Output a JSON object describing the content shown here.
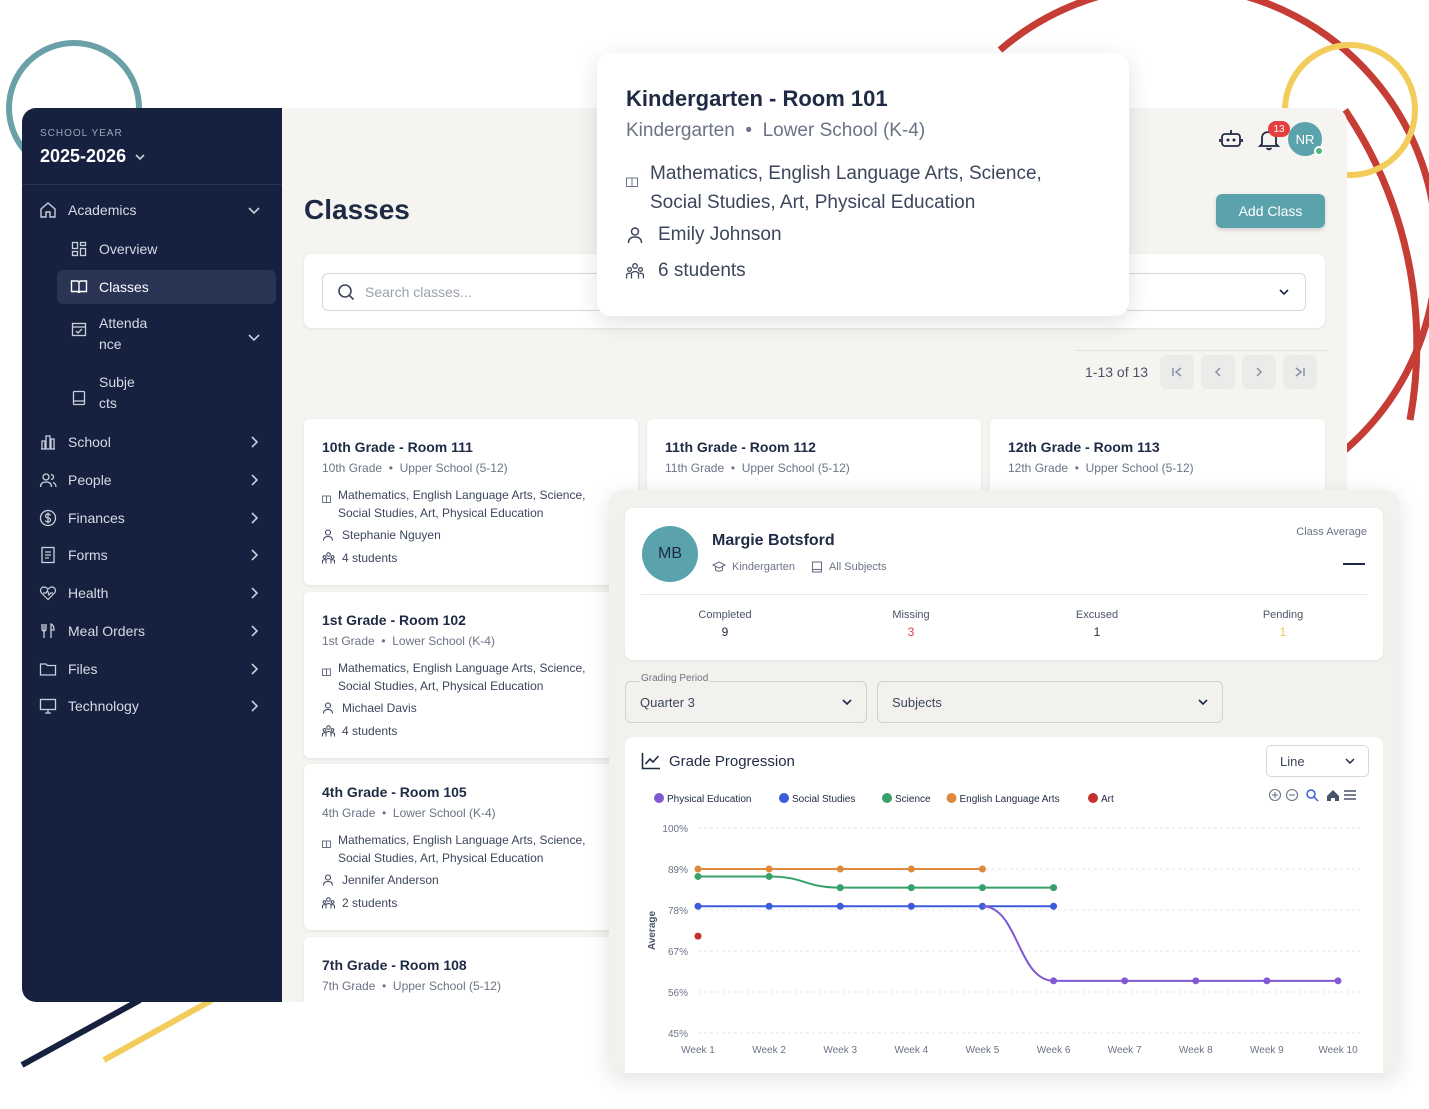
{
  "school_year": {
    "label": "SCHOOL YEAR",
    "value": "2025-2026"
  },
  "sidebar": {
    "items": [
      {
        "label": "Academics",
        "icon": "home-icon",
        "expanded": true
      },
      {
        "label": "Overview",
        "icon": "dashboard-icon"
      },
      {
        "label": "Classes",
        "icon": "book-icon",
        "active": true
      },
      {
        "label_line1": "Attenda",
        "label_line2": "nce",
        "icon": "calendar-check-icon"
      },
      {
        "label_line1": "Subje",
        "label_line2": "cts",
        "icon": "notebook-icon"
      },
      {
        "label": "School",
        "icon": "building-icon"
      },
      {
        "label": "People",
        "icon": "users-icon"
      },
      {
        "label": "Finances",
        "icon": "dollar-icon"
      },
      {
        "label": "Forms",
        "icon": "form-icon"
      },
      {
        "label": "Health",
        "icon": "heart-icon"
      },
      {
        "label": "Meal Orders",
        "icon": "utensils-icon"
      },
      {
        "label": "Files",
        "icon": "folder-icon"
      },
      {
        "label": "Technology",
        "icon": "monitor-icon"
      }
    ]
  },
  "header": {
    "title": "Classes",
    "add_button": "Add Class",
    "notification_count": "13",
    "user_initials": "NR"
  },
  "search": {
    "placeholder": "Search classes..."
  },
  "pagination": {
    "range": "1-13 of 13"
  },
  "classes": [
    {
      "title": "10th Grade - Room 111",
      "grade": "10th Grade",
      "division": "Upper School (5-12)",
      "subjects": "Mathematics, English Language Arts, Science, Social Studies, Art, Physical Education",
      "teacher": "Stephanie Nguyen",
      "students": "4 students"
    },
    {
      "title": "11th Grade - Room 112",
      "grade": "11th Grade",
      "division": "Upper School (5-12)"
    },
    {
      "title": "12th Grade - Room 113",
      "grade": "12th Grade",
      "division": "Upper School (5-12)"
    },
    {
      "title": "1st Grade - Room 102",
      "grade": "1st Grade",
      "division": "Lower School (K-4)",
      "subjects": "Mathematics, English Language Arts, Science, Social Studies, Art, Physical Education",
      "teacher": "Michael Davis",
      "students": "4 students"
    },
    {
      "title": "4th Grade - Room 105",
      "grade": "4th Grade",
      "division": "Lower School (K-4)",
      "subjects": "Mathematics, English Language Arts, Science, Social Studies, Art, Physical Education",
      "teacher": "Jennifer Anderson",
      "students": "2 students"
    },
    {
      "title": "7th Grade - Room 108",
      "grade": "7th Grade",
      "division": "Upper School (5-12)"
    }
  ],
  "popover": {
    "title": "Kindergarten - Room 101",
    "grade": "Kindergarten",
    "division": "Lower School (K-4)",
    "subjects": "Mathematics, English Language Arts, Science, Social Studies, Art, Physical Education",
    "teacher": "Emily Johnson",
    "students": "6 students"
  },
  "student": {
    "initials": "MB",
    "name": "Margie Botsford",
    "grade": "Kindergarten",
    "subjects": "All Subjects",
    "class_average_label": "Class Average",
    "stats": [
      {
        "label": "Completed",
        "value": "9",
        "color": "#1f2a44"
      },
      {
        "label": "Missing",
        "value": "3",
        "color": "#e53e3e"
      },
      {
        "label": "Excused",
        "value": "1",
        "color": "#1f2a44"
      },
      {
        "label": "Pending",
        "value": "1",
        "color": "#ecc94b"
      }
    ]
  },
  "filters": {
    "grading_period_label": "Grading Period",
    "grading_period_value": "Quarter 3",
    "subjects_value": "Subjects"
  },
  "chart_title": "Grade Progression",
  "chart_type_select": "Line",
  "chart_data": {
    "type": "line",
    "ylabel": "Average",
    "ylim": [
      45,
      100
    ],
    "y_ticks": [
      "100%",
      "89%",
      "78%",
      "67%",
      "56%",
      "45%"
    ],
    "y_tick_values": [
      100,
      89,
      78,
      67,
      56,
      45
    ],
    "categories": [
      "Week 1",
      "Week 2",
      "Week 3",
      "Week 4",
      "Week 5",
      "Week 6",
      "Week 7",
      "Week 8",
      "Week 9",
      "Week 10"
    ],
    "grid": true,
    "legend_position": "top-left",
    "series": [
      {
        "name": "Physical Education",
        "color": "#805ad5",
        "values": [
          null,
          null,
          null,
          null,
          null,
          59,
          59,
          59,
          59,
          59
        ]
      },
      {
        "name": "Social Studies",
        "color": "#3b5bdb",
        "values": [
          79,
          79,
          79,
          79,
          79,
          79,
          null,
          null,
          null,
          null
        ]
      },
      {
        "name": "Science",
        "color": "#38a169",
        "values": [
          87,
          87,
          84,
          84,
          84,
          84,
          null,
          null,
          null,
          null
        ]
      },
      {
        "name": "English Language Arts",
        "color": "#dd8a3c",
        "values": [
          89,
          89,
          89,
          89,
          89,
          null,
          null,
          null,
          null,
          null
        ]
      },
      {
        "name": "Art",
        "color": "#c53030",
        "values": [
          71,
          null,
          null,
          null,
          null,
          null,
          null,
          null,
          null,
          null
        ]
      }
    ]
  },
  "colors": {
    "sidebar": "#16213f",
    "accent": "#5aa3ad",
    "background": "#f5f4f1"
  }
}
